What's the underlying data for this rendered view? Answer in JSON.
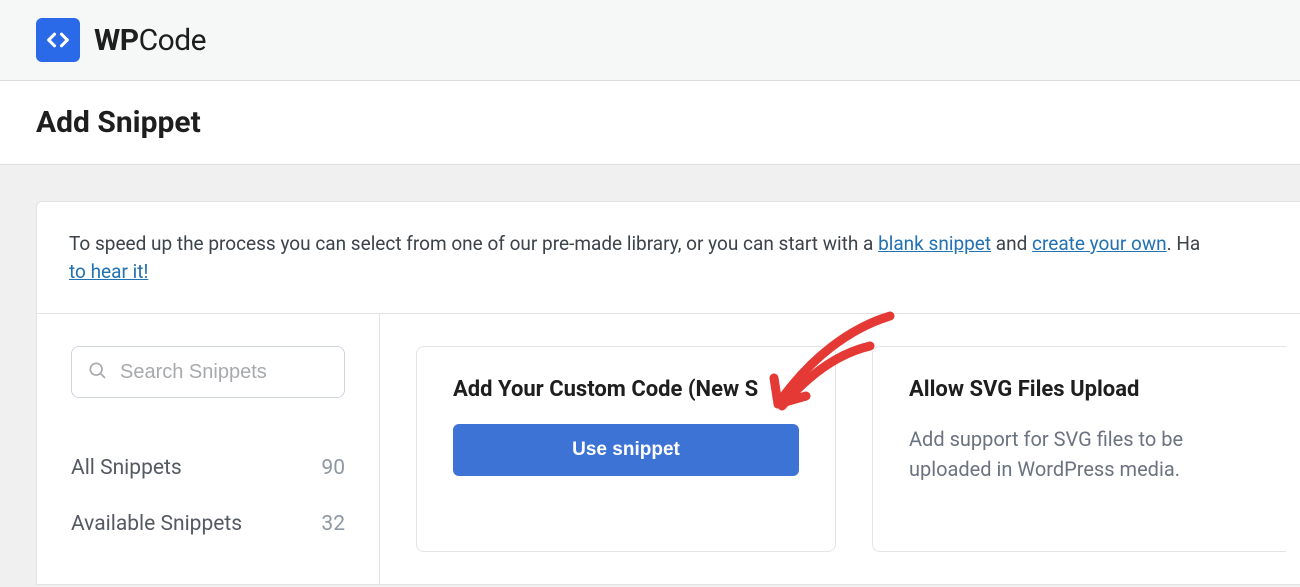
{
  "brand": {
    "name_bold": "WP",
    "name_light": "Code"
  },
  "page": {
    "title": "Add Snippet"
  },
  "intro": {
    "prefix": "To speed up the process you can select from one of our pre-made library, or you can start with a ",
    "link_blank": "blank snippet",
    "mid": " and ",
    "link_create": "create your own",
    "suffix_trunc": ". Ha",
    "link_hear": "to hear it!"
  },
  "search": {
    "placeholder": "Search Snippets"
  },
  "filters": [
    {
      "label": "All Snippets",
      "count": "90"
    },
    {
      "label": "Available Snippets",
      "count": "32"
    }
  ],
  "cards": {
    "custom": {
      "title": "Add Your Custom Code (New S",
      "button": "Use snippet"
    },
    "svg": {
      "title": "Allow SVG Files Upload",
      "desc": "Add support for SVG files to be uploaded in WordPress media."
    }
  }
}
